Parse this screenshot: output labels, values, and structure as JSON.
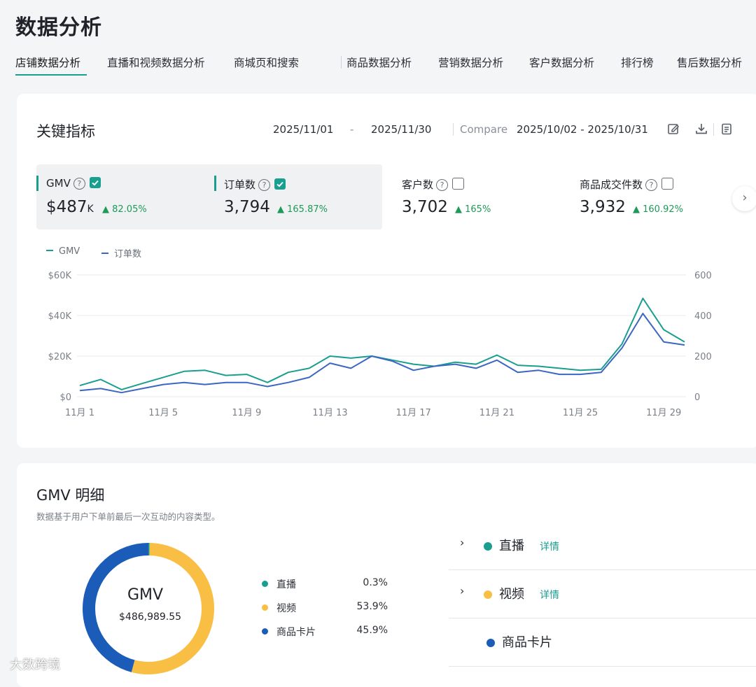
{
  "page": {
    "title": "数据分析"
  },
  "tabs": [
    {
      "label": "店铺数据分析",
      "active": true
    },
    {
      "label": "直播和视频数据分析"
    },
    {
      "label": "商城页和搜索"
    },
    {
      "label": "商品数据分析"
    },
    {
      "label": "营销数据分析"
    },
    {
      "label": "客户数据分析"
    },
    {
      "label": "排行榜"
    },
    {
      "label": "售后数据分析"
    }
  ],
  "key_metrics": {
    "title": "关键指标",
    "date_start": "2025/11/01",
    "date_sep": "-",
    "date_end": "2025/11/30",
    "compare_label": "Compare",
    "compare_range": "2025/10/02 - 2025/10/31",
    "icons": [
      "edit-icon",
      "download-icon",
      "clipboard-icon"
    ],
    "metrics": [
      {
        "label": "GMV",
        "value_prefix": "$",
        "value": "487",
        "value_suffix": "K",
        "delta": "▲ 82.05%",
        "checked": true
      },
      {
        "label": "订单数",
        "value": "3,794",
        "delta": "▲ 165.87%",
        "checked": true
      },
      {
        "label": "客户数",
        "value": "3,702",
        "delta": "▲ 165%",
        "checked": false
      },
      {
        "label": "商品成交件数",
        "value": "3,932",
        "delta": "▲ 160.92%",
        "checked": false
      }
    ],
    "legend": [
      {
        "label": "GMV",
        "color": "#1a9e8f"
      },
      {
        "label": "订单数",
        "color": "#3b67c2"
      }
    ]
  },
  "chart_data": {
    "type": "line",
    "x_ticks": [
      "11月 1",
      "11月 5",
      "11月 9",
      "11月 13",
      "11月 17",
      "11月 21",
      "11月 25",
      "11月 29"
    ],
    "x": [
      1,
      2,
      3,
      4,
      5,
      6,
      7,
      8,
      9,
      10,
      11,
      12,
      13,
      14,
      15,
      16,
      17,
      18,
      19,
      20,
      21,
      22,
      23,
      24,
      25,
      26,
      27,
      28,
      29,
      30
    ],
    "y_left_ticks": [
      "$0",
      "$20K",
      "$40K",
      "$60K"
    ],
    "y_right_ticks": [
      "0",
      "200",
      "400",
      "600"
    ],
    "ylim_left": [
      0,
      60000
    ],
    "ylim_right": [
      0,
      600
    ],
    "grid": true,
    "series": [
      {
        "name": "GMV",
        "axis": "left",
        "color": "#1a9e8f",
        "values": [
          5500,
          8500,
          3500,
          6500,
          9500,
          12500,
          13000,
          10500,
          11000,
          7000,
          12000,
          14000,
          20000,
          19000,
          20000,
          18000,
          16000,
          15000,
          17000,
          16000,
          20500,
          15500,
          15000,
          14000,
          13000,
          13500,
          26000,
          48500,
          33000,
          27000
        ]
      },
      {
        "name": "订单数",
        "axis": "right",
        "color": "#3b67c2",
        "values": [
          30,
          40,
          20,
          40,
          60,
          70,
          60,
          70,
          70,
          50,
          70,
          95,
          165,
          140,
          200,
          175,
          130,
          150,
          160,
          140,
          180,
          120,
          130,
          110,
          110,
          120,
          240,
          410,
          270,
          255
        ]
      }
    ]
  },
  "gmv_breakdown": {
    "title": "GMV 明细",
    "subtitle": "数据基于用户下单前最后一次互动的内容类型。",
    "center_title": "GMV",
    "center_value": "$486,989.55",
    "segments": [
      {
        "label": "直播",
        "pct": "0.3%",
        "value": 0.3,
        "color": "#1a9e8f"
      },
      {
        "label": "视频",
        "pct": "53.9%",
        "value": 53.9,
        "color": "#f9bf45"
      },
      {
        "label": "商品卡片",
        "pct": "45.9%",
        "value": 45.9,
        "color": "#1b5cb8"
      }
    ],
    "rows": [
      {
        "label": "直播",
        "link": "详情",
        "color": "#1a9e8f",
        "expandable": true
      },
      {
        "label": "视频",
        "link": "详情",
        "color": "#f9bf45",
        "expandable": true
      },
      {
        "label": "商品卡片",
        "link": "",
        "color": "#1b5cb8",
        "expandable": false
      }
    ]
  },
  "watermark": {
    "text": "大数跨境"
  }
}
